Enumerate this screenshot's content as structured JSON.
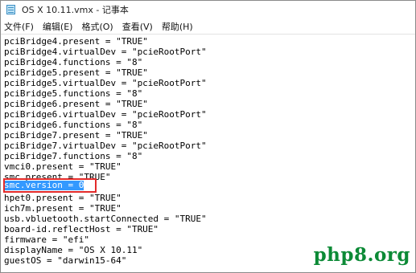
{
  "window": {
    "title": "OS X 10.11.vmx - 记事本"
  },
  "menu": [
    {
      "label": "文件(F)"
    },
    {
      "label": "编辑(E)"
    },
    {
      "label": "格式(O)"
    },
    {
      "label": "查看(V)"
    },
    {
      "label": "帮助(H)"
    }
  ],
  "lines": [
    "pciBridge4.present = \"TRUE\"",
    "pciBridge4.virtualDev = \"pcieRootPort\"",
    "pciBridge4.functions = \"8\"",
    "pciBridge5.present = \"TRUE\"",
    "pciBridge5.virtualDev = \"pcieRootPort\"",
    "pciBridge5.functions = \"8\"",
    "pciBridge6.present = \"TRUE\"",
    "pciBridge6.virtualDev = \"pcieRootPort\"",
    "pciBridge6.functions = \"8\"",
    "pciBridge7.present = \"TRUE\"",
    "pciBridge7.virtualDev = \"pcieRootPort\"",
    "pciBridge7.functions = \"8\"",
    "vmci0.present = \"TRUE\"",
    "smc.present = \"TRUE\"",
    "",
    "hpet0.present = \"TRUE\"",
    "ich7m.present = \"TRUE\"",
    "usb.vbluetooth.startConnected = \"TRUE\"",
    "board-id.reflectHost = \"TRUE\"",
    "firmware = \"efi\"",
    "displayName = \"OS X 10.11\"",
    "guestOS = \"darwin15-64\""
  ],
  "selected_text": "smc.version = 0",
  "watermark": "php8.org",
  "colors": {
    "selection": "#3399ff",
    "highlight_box": "#e32b2b",
    "watermark": "#0c8a36"
  }
}
